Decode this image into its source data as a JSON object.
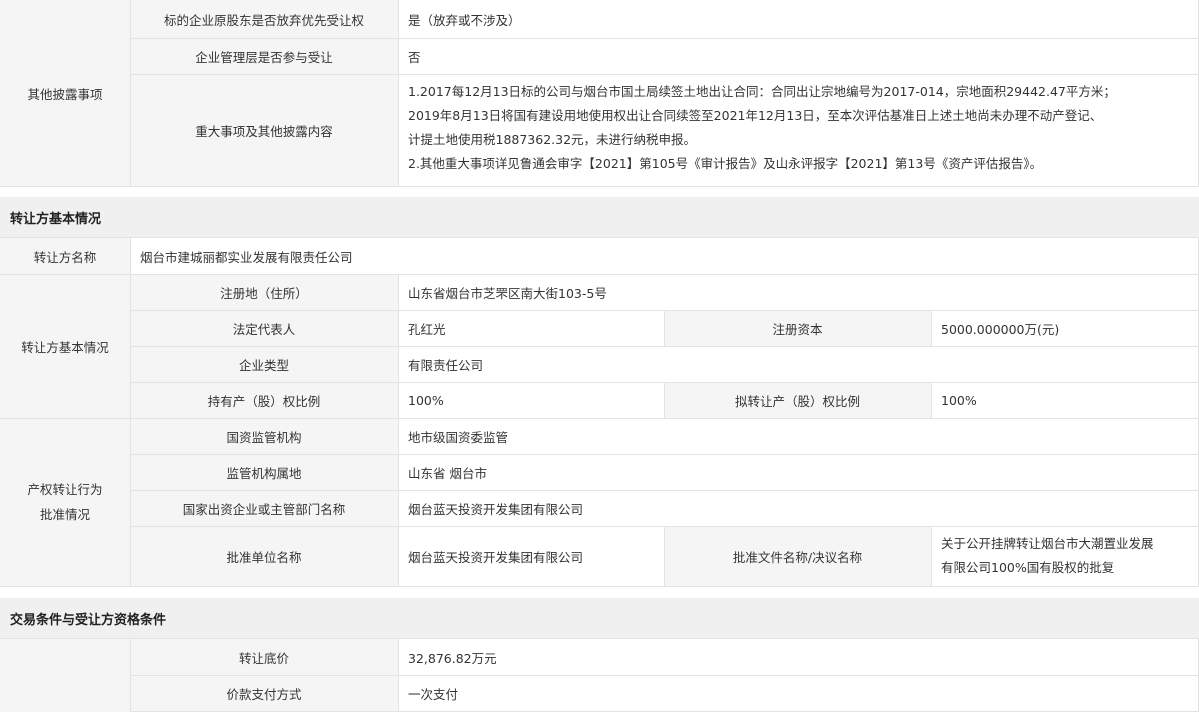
{
  "other": {
    "group_label": "其他披露事项",
    "rows": [
      {
        "label": "标的企业原股东是否放弃优先受让权",
        "value": "是（放弃或不涉及）"
      },
      {
        "label": "企业管理层是否参与受让",
        "value": "否"
      },
      {
        "label": "重大事项及其他披露内容",
        "lines": [
          "1.2017每12月13日标的公司与烟台市国土局续签土地出让合同：合同出让宗地编号为2017-014，宗地面积29442.47平方米；",
          "2019年8月13日将国有建设用地使用权出让合同续签至2021年12月13日，至本次评估基准日上述土地尚未办理不动产登记、",
          "计提土地使用税1887362.32元，未进行纳税申报。",
          "2.其他重大事项详见鲁通会审字【2021】第105号《审计报告》及山永评报字【2021】第13号《资产评估报告》。"
        ]
      }
    ]
  },
  "transferor": {
    "section_title": "转让方基本情况",
    "name_label": "转让方名称",
    "name_value": "烟台市建城丽都实业发展有限责任公司",
    "basic_group_label": "转让方基本情况",
    "reg_addr_label": "注册地（住所）",
    "reg_addr_value": "山东省烟台市芝罘区南大街103-5号",
    "legal_rep_label": "法定代表人",
    "legal_rep_value": "孔红光",
    "reg_capital_label": "注册资本",
    "reg_capital_value": "5000.000000万(元)",
    "ent_type_label": "企业类型",
    "ent_type_value": "有限责任公司",
    "hold_ratio_label": "持有产（股）权比例",
    "hold_ratio_value": "100%",
    "plan_ratio_label": "拟转让产（股）权比例",
    "plan_ratio_value": "100%"
  },
  "approval": {
    "group_label_line1": "产权转让行为",
    "group_label_line2": "批准情况",
    "regulator_label": "国资监管机构",
    "regulator_value": "地市级国资委监管",
    "region_label": "监管机构属地",
    "region_value": "山东省 烟台市",
    "parent_label": "国家出资企业或主管部门名称",
    "parent_value": "烟台蓝天投资开发集团有限公司",
    "approver_label": "批准单位名称",
    "approver_value": "烟台蓝天投资开发集团有限公司",
    "doc_label": "批准文件名称/决议名称",
    "doc_line1": "关于公开挂牌转让烟台市大潮置业发展",
    "doc_line2": "有限公司100%国有股权的批复"
  },
  "trade": {
    "section_title": "交易条件与受让方资格条件",
    "price_label": "转让底价",
    "price_value": "32,876.82万元",
    "payment_label": "价款支付方式",
    "payment_value": "一次支付"
  }
}
